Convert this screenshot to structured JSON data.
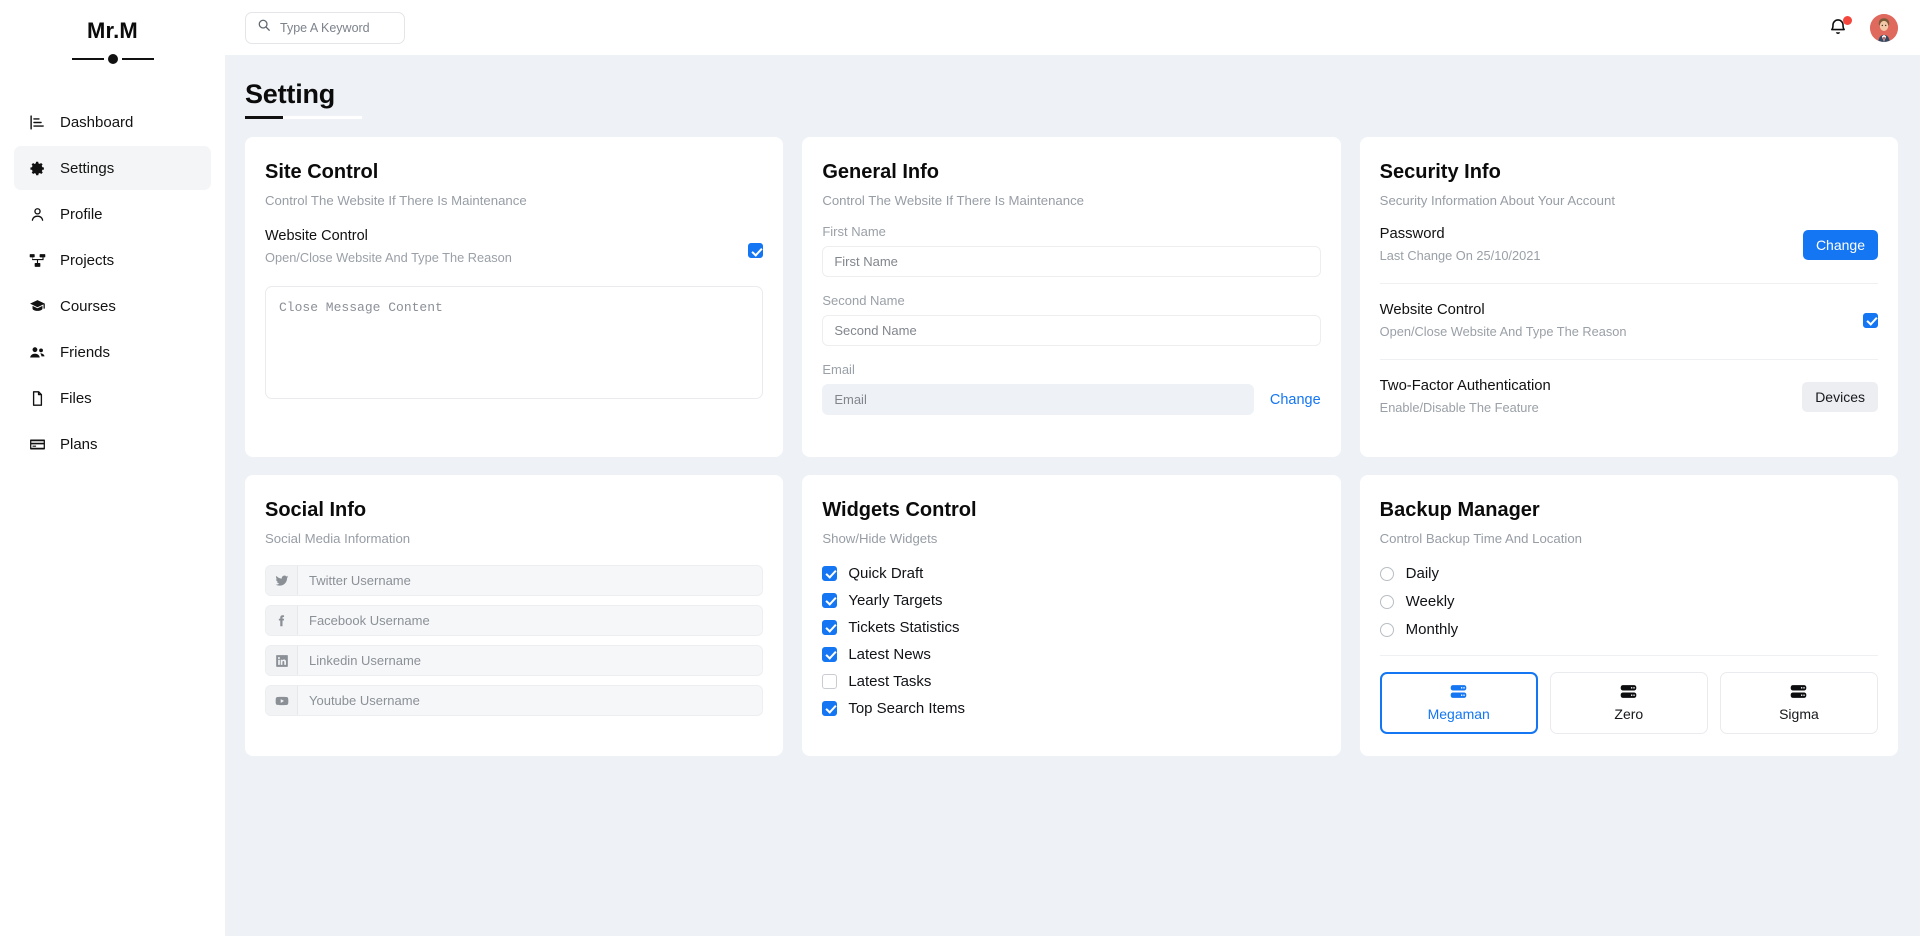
{
  "sidebar": {
    "brand": "Mr.M",
    "items": [
      {
        "label": "Dashboard",
        "icon": "chart-bar-icon",
        "active": false
      },
      {
        "label": "Settings",
        "icon": "gear-icon",
        "active": true
      },
      {
        "label": "Profile",
        "icon": "user-icon",
        "active": false
      },
      {
        "label": "Projects",
        "icon": "project-diagram-icon",
        "active": false
      },
      {
        "label": "Courses",
        "icon": "graduation-cap-icon",
        "active": false
      },
      {
        "label": "Friends",
        "icon": "users-icon",
        "active": false
      },
      {
        "label": "Files",
        "icon": "file-icon",
        "active": false
      },
      {
        "label": "Plans",
        "icon": "credit-card-icon",
        "active": false
      }
    ]
  },
  "topbar": {
    "search_placeholder": "Type A Keyword",
    "search_value": "",
    "search_icon": "search-icon",
    "notification_icon": "bell-icon",
    "notification_badge": true,
    "avatar_icon": "avatar"
  },
  "page": {
    "title": "Setting"
  },
  "site_control": {
    "title": "Site Control",
    "subtitle": "Control The Website If There Is Maintenance",
    "toggle_label": "Website Control",
    "toggle_sub": "Open/Close Website And Type The Reason",
    "toggle_checked": true,
    "textarea_placeholder": "Close Message Content",
    "textarea_value": ""
  },
  "general_info": {
    "title": "General Info",
    "subtitle": "Control The Website If There Is Maintenance",
    "fields": [
      {
        "label": "First Name",
        "placeholder": "First Name",
        "value": "",
        "disabled": false
      },
      {
        "label": "Second Name",
        "placeholder": "Second Name",
        "value": "",
        "disabled": false
      },
      {
        "label": "Email",
        "placeholder": "Email",
        "value": "",
        "disabled": true
      }
    ],
    "email_change_label": "Change"
  },
  "security_info": {
    "title": "Security Info",
    "subtitle": "Security Information About Your Account",
    "password": {
      "label": "Password",
      "sub": "Last Change On 25/10/2021",
      "button": "Change"
    },
    "website_control": {
      "label": "Website Control",
      "sub": "Open/Close Website And Type The Reason",
      "checked": true
    },
    "two_factor": {
      "label": "Two-Factor Authentication",
      "sub": "Enable/Disable The Feature",
      "button": "Devices"
    }
  },
  "social_info": {
    "title": "Social Info",
    "subtitle": "Social Media Information",
    "fields": [
      {
        "icon": "twitter-icon",
        "placeholder": "Twitter Username",
        "value": ""
      },
      {
        "icon": "facebook-icon",
        "placeholder": "Facebook Username",
        "value": ""
      },
      {
        "icon": "linkedin-icon",
        "placeholder": "Linkedin Username",
        "value": ""
      },
      {
        "icon": "youtube-icon",
        "placeholder": "Youtube Username",
        "value": ""
      }
    ]
  },
  "widgets_control": {
    "title": "Widgets Control",
    "subtitle": "Show/Hide Widgets",
    "items": [
      {
        "label": "Quick Draft",
        "checked": true
      },
      {
        "label": "Yearly Targets",
        "checked": true
      },
      {
        "label": "Tickets Statistics",
        "checked": true
      },
      {
        "label": "Latest News",
        "checked": true
      },
      {
        "label": "Latest Tasks",
        "checked": false
      },
      {
        "label": "Top Search Items",
        "checked": true
      }
    ]
  },
  "backup_manager": {
    "title": "Backup Manager",
    "subtitle": "Control Backup Time And Location",
    "schedules": [
      {
        "label": "Daily",
        "checked": false
      },
      {
        "label": "Weekly",
        "checked": false
      },
      {
        "label": "Monthly",
        "checked": false
      }
    ],
    "servers": [
      {
        "label": "Megaman",
        "icon": "server-icon",
        "selected": true
      },
      {
        "label": "Zero",
        "icon": "server-icon",
        "selected": false
      },
      {
        "label": "Sigma",
        "icon": "server-icon",
        "selected": false
      }
    ]
  },
  "colors": {
    "accent": "#1476f2",
    "page_bg": "#eef1f6",
    "card_bg": "#ffffff",
    "muted_text": "#9aa0a7",
    "notification": "#f4463c"
  }
}
